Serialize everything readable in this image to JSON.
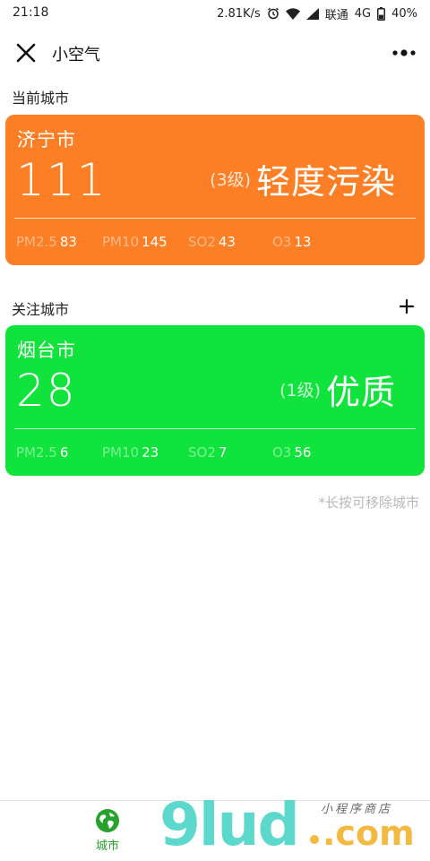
{
  "status_bar": {
    "time": "21:18",
    "network_speed": "2.81K/s",
    "carrier": "联通",
    "network_type": "4G",
    "battery": "40%",
    "icons": [
      "alarm-icon",
      "wifi-icon",
      "signal-icon",
      "battery-icon"
    ]
  },
  "nav": {
    "title": "小空气",
    "close_icon": "close-icon",
    "more_icon": "more-dots-icon"
  },
  "current_section": {
    "title": "当前城市"
  },
  "current_city": {
    "name": "济宁市",
    "aqi": "111",
    "grade": "(3级)",
    "level": "轻度污染",
    "color": "#fd7f25",
    "pollutants": [
      {
        "name": "PM2.5",
        "value": "83"
      },
      {
        "name": "PM10",
        "value": "145"
      },
      {
        "name": "SO2",
        "value": "43"
      },
      {
        "name": "O3",
        "value": "13"
      }
    ]
  },
  "followed_section": {
    "title": "关注城市",
    "add_icon": "plus-icon"
  },
  "followed_cities": [
    {
      "name": "烟台市",
      "aqi": "28",
      "grade": "(1级)",
      "level": "优质",
      "color": "#10e43c",
      "pollutants": [
        {
          "name": "PM2.5",
          "value": "6"
        },
        {
          "name": "PM10",
          "value": "23"
        },
        {
          "name": "SO2",
          "value": "7"
        },
        {
          "name": "O3",
          "value": "56"
        }
      ]
    }
  ],
  "hint": "*长按可移除城市",
  "tab_bar": {
    "items": [
      {
        "label": "城市",
        "icon": "globe-icon",
        "active": true,
        "color": "#29a12d"
      }
    ]
  },
  "watermark": {
    "logo": "9lud",
    "domain": ".com",
    "subtitle": "小程序商店"
  }
}
